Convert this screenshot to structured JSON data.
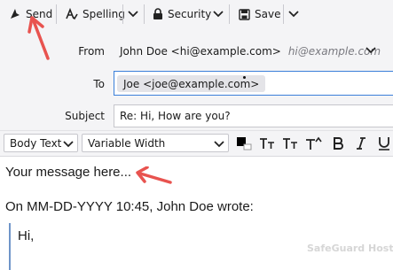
{
  "toolbar": {
    "send_label": "Send",
    "spelling_label": "Spelling",
    "security_label": "Security",
    "save_label": "Save"
  },
  "header": {
    "from_label": "From",
    "from_value": "John Doe <hi@example.com>",
    "from_hint": "hi@example.com",
    "to_label": "To",
    "to_recipient": "Joe <joe@example.com>",
    "subject_label": "Subject",
    "subject_value": "Re: Hi, How are you?"
  },
  "format_bar": {
    "paragraph_style": "Body Text",
    "font": "Variable Width"
  },
  "message": {
    "placeholder_line": "Your message here...",
    "attribution": "On MM-DD-YYYY 10:45, John Doe wrote:",
    "quoted_line": "Hi,"
  },
  "watermark": "SafeGuard Hosting",
  "colors": {
    "accent": "#3b7fd9",
    "annotation_arrow": "#e8534f",
    "quote_bar": "#6f95c9"
  }
}
